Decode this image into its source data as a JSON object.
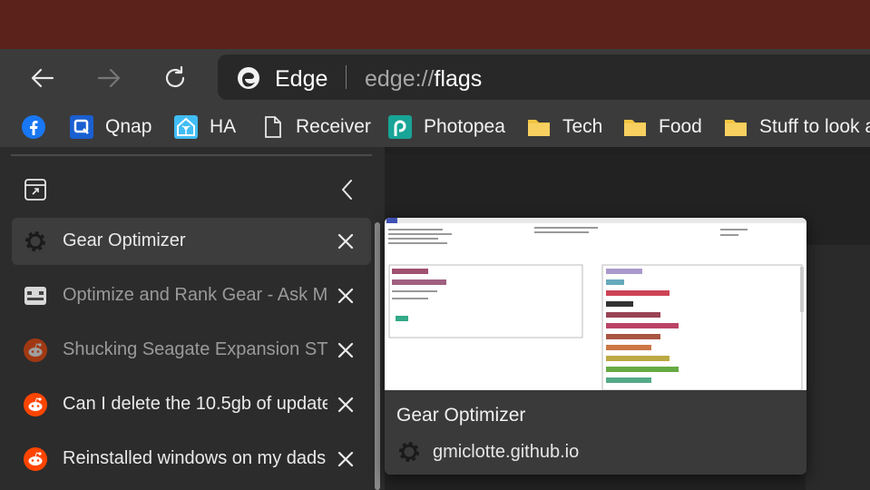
{
  "address_bar": {
    "browser_label": "Edge",
    "url_scheme": "edge://",
    "url_host": "flags"
  },
  "bookmarks": [
    {
      "label": "",
      "icon": "facebook-icon"
    },
    {
      "label": "Qnap",
      "icon": "qnap-icon"
    },
    {
      "label": "HA",
      "icon": "home-assistant-icon"
    },
    {
      "label": "Receiver",
      "icon": "document-icon"
    },
    {
      "label": "Photopea",
      "icon": "photopea-icon"
    },
    {
      "label": "Tech",
      "icon": "folder-icon"
    },
    {
      "label": "Food",
      "icon": "folder-icon"
    },
    {
      "label": "Stuff to look a",
      "icon": "folder-icon"
    }
  ],
  "vertical_tabs": [
    {
      "title": "Gear Optimizer",
      "icon": "gear-icon",
      "active": true
    },
    {
      "title": "Optimize and Rank Gear - Ask M",
      "icon": "site-icon",
      "active": false
    },
    {
      "title": "Shucking Seagate Expansion STE",
      "icon": "reddit-icon",
      "active": false
    },
    {
      "title": "Can I delete the 10.5gb of update",
      "icon": "reddit-icon",
      "active": false
    },
    {
      "title": "Reinstalled windows on my dads",
      "icon": "reddit-icon",
      "active": false
    }
  ],
  "hover_card": {
    "title": "Gear Optimizer",
    "url": "gmiclotte.github.io"
  },
  "colors": {
    "titlebar": "#5b221c",
    "toolbar": "#3b3b3b",
    "address_bar": "#282828",
    "folder": "#f4c542",
    "reddit": "#ff4500",
    "facebook": "#1877f2"
  }
}
